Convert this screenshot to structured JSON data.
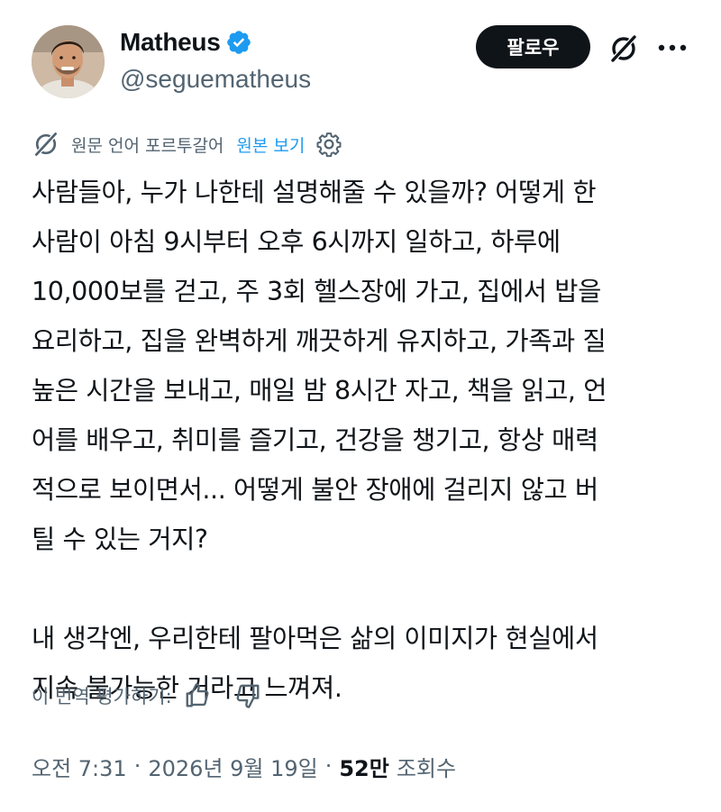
{
  "user": {
    "display_name": "Matheus",
    "handle": "@seguematheus",
    "verified": true,
    "verified_color": "#1d9bf0"
  },
  "actions": {
    "follow_label": "팔로우",
    "grok_icon": "grok-icon",
    "more_icon": "more-horizontal-icon"
  },
  "translation": {
    "label": "원문 언어 포르투갈어",
    "show_original": "원본 보기",
    "accent_color": "#1d9bf0"
  },
  "tweet": {
    "lines": [
      "사람들아, 누가 나한테 설명해줄 수 있을까? 어떻게 한",
      "사람이 아침 9시부터 오후 6시까지 일하고, 하루에",
      "10,000보를 걷고, 주 3회 헬스장에 가고, 집에서 밥을",
      "요리하고, 집을 완벽하게 깨끗하게 유지하고, 가족과 질",
      "높은 시간을 보내고, 매일 밤 8시간 자고, 책을 읽고, 언",
      "어를 배우고, 취미를 즐기고, 건강을 챙기고, 항상 매력",
      "적으로 보이면서... 어떻게 불안 장애에 걸리지 않고 버",
      "틸 수 있는 거지?"
    ],
    "lines2": [
      "내 생각엔, 우리한테 팔아먹은 삶의 이미지가 현실에서",
      "지속 불가능한 거라고 느껴져."
    ]
  },
  "rating": {
    "label": "이 번역 평가하기:"
  },
  "meta": {
    "time": "오전 7:31",
    "separator": "·",
    "date": "2026년 9월 19일",
    "views_count": "52만",
    "views_label": "조회수"
  }
}
